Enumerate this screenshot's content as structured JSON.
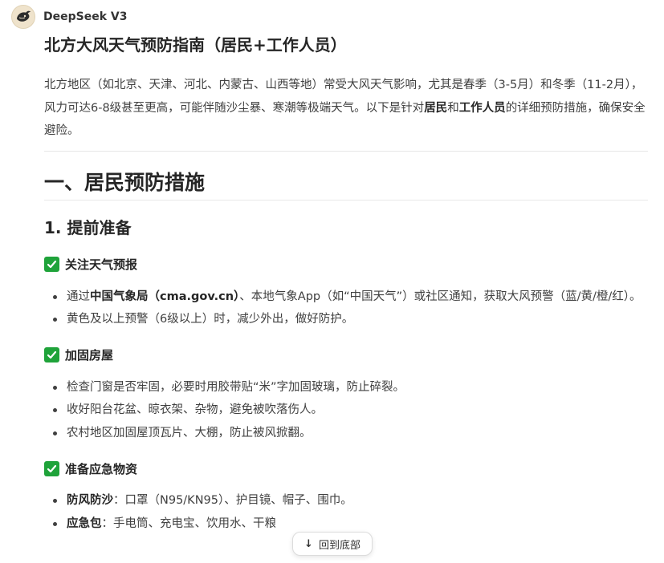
{
  "app": {
    "model_name": "DeepSeek V3",
    "logo_icon": "deepseek-whale-icon"
  },
  "doc": {
    "title": "北方大风天气预防指南（居民+工作人员）",
    "intro": {
      "part1": "北方地区（如北京、天津、河北、内蒙古、山西等地）常受大风天气影响，尤其是春季（3-5月）和冬季（11-2月），风力可达6-8级甚至更高，可能伴随沙尘暴、寒潮等极端天气。以下是针对",
      "bold1": "居民",
      "mid": "和",
      "bold2": "工作人员",
      "part2": "的详细预防措施，确保安全避险。"
    },
    "section1": {
      "title": "一、居民预防措施",
      "sub1": {
        "title": "1. 提前准备",
        "groups": [
          {
            "title": "关注天气预报",
            "items": [
              {
                "pre": "通过",
                "bold": "中国气象局（cma.gov.cn）",
                "post": "、本地气象App（如“中国天气”）或社区通知，获取大风预警（蓝/黄/橙/红）。"
              },
              {
                "pre": "黄色及以上预警（6级以上）时，减少外出，做好防护。",
                "bold": "",
                "post": ""
              }
            ]
          },
          {
            "title": "加固房屋",
            "items": [
              {
                "pre": "检查门窗是否牢固，必要时用胶带贴“米”字加固玻璃，防止碎裂。",
                "bold": "",
                "post": ""
              },
              {
                "pre": "收好阳台花盆、晾衣架、杂物，避免被吹落伤人。",
                "bold": "",
                "post": ""
              },
              {
                "pre": "农村地区加固屋顶瓦片、大棚，防止被风掀翻。",
                "bold": "",
                "post": ""
              }
            ]
          },
          {
            "title": "准备应急物资",
            "items": [
              {
                "pre": "",
                "bold": "防风防沙",
                "post": "：口罩（N95/KN95）、护目镜、帽子、围巾。"
              },
              {
                "pre": "",
                "bold": "应急包",
                "post": "：手电筒、充电宝、饮用水、干粮"
              }
            ]
          }
        ]
      }
    }
  },
  "scroll_button": {
    "label": "回到底部",
    "icon": "arrow-down-icon"
  },
  "colors": {
    "check": "#1fa33a",
    "text": "#404040",
    "heading": "#262626"
  }
}
